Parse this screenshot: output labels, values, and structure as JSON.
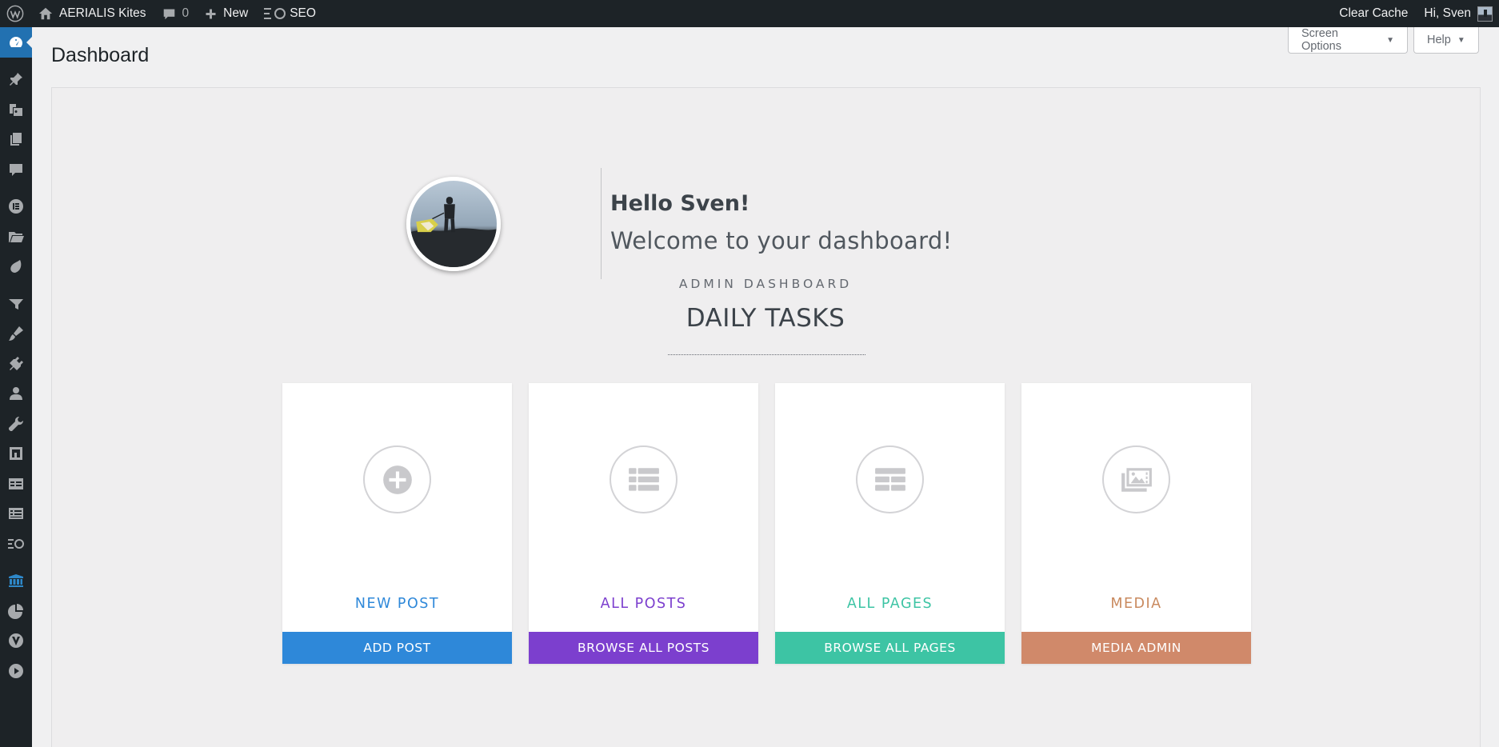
{
  "adminbar": {
    "site_name": "AERIALIS Kites",
    "comments_count": "0",
    "new_label": "New",
    "seo_label": "SEO",
    "clear_cache": "Clear Cache",
    "greeting": "Hi, Sven"
  },
  "sidebar": {
    "items": [
      "dashboard-icon",
      "pin-icon",
      "media-icon",
      "pages-icon",
      "comments-icon",
      "elementor-icon",
      "folder-icon",
      "drop-icon",
      "funnel-icon",
      "appearance-icon",
      "plugins-icon",
      "users-icon",
      "tools-icon",
      "settings-icon",
      "table-icon",
      "form-icon",
      "seo-icon",
      "library-icon",
      "chart-icon",
      "vector-icon",
      "play-icon"
    ],
    "active": "dashboard-icon"
  },
  "page": {
    "title": "Dashboard",
    "screen_options": "Screen Options",
    "help": "Help"
  },
  "welcome": {
    "hello": "Hello Sven!",
    "message": "Welcome to your dashboard!"
  },
  "section": {
    "subtitle": "ADMIN DASHBOARD",
    "title": "DAILY TASKS"
  },
  "cards": [
    {
      "title": "NEW POST",
      "button": "ADD POST",
      "color": "#2e88d9",
      "icon": "plus-circle-icon"
    },
    {
      "title": "ALL POSTS",
      "button": "BROWSE ALL POSTS",
      "color": "#7c3fce",
      "icon": "list-icon"
    },
    {
      "title": "ALL PAGES",
      "button": "BROWSE ALL PAGES",
      "color": "#3dc4a4",
      "icon": "grid-list-icon"
    },
    {
      "title": "MEDIA",
      "button": "MEDIA ADMIN",
      "color": "#d0896a",
      "icon": "photos-icon"
    }
  ],
  "colors": {
    "adminbar": "#1d2327",
    "sidebar_active": "#2271b1",
    "panel_bg": "#efeeef"
  }
}
